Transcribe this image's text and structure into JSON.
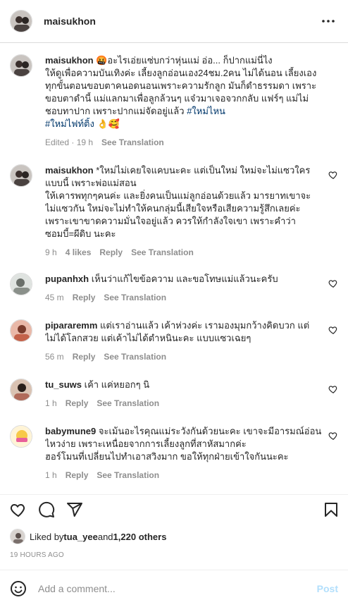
{
  "header": {
    "username": "maisukhon",
    "more_icon": "more-horizontal-icon"
  },
  "comments": [
    {
      "username": "maisukhon",
      "lines": [
        " 🤬อะไรเอ่ยแซ่บกว่าหุ่นแม่ อ่อ... ก็ปากแม่นี่ไง",
        "ให้ดูเพื่อความบันเทิงค่ะ เลี้ยงลูกอ่อนเอง24ชม.2คน ไม่ได้นอน เลี้ยงเอง",
        "ทุกขั้นตอนขอบตาคนอดนอนเพราะความรักลูก มันก็ดำธรรมดา เพราะ",
        "ขอบตาดำนี้ แม่แลกมาเพื่อลูกล้วนๆ แจ๋วมาเจอจวกกลับ แฟร์ๆ แม่ไม่",
        "ชอบทาปาก เพราะปากแม่จัดอยู่แล้ว "
      ],
      "hashtag_1": "#ใหม่ไหน",
      "hashtag_2": "#ใหม่ไฟท์ติ้ง",
      "emoji_tail": " 👌🥰",
      "edited": "Edited · 19 h",
      "see_translation": "See Translation"
    },
    {
      "username": "maisukhon",
      "lines": [
        " *ใหม่ไม่เคยใจแคบนะคะ แต่เป็นใหม่ ใหม่จะไม่แซวใคร",
        "แบบนี้ เพราะพ่อแม่สอน",
        "ให้เคารพทุกๆคนค่ะ และยิ่งคนเป็นแม่ลูกอ่อนด้วยแล้ว มารยาทเขาจะ",
        "ไม่แซวกัน ใหม่จะไม่ทำให้คนกลุ่มนี้เสียใจหรือเสียความรู้สึกเลยค่ะ",
        "เพราะเขาขาดความมั่นใจอยู่แล้ว ควรให้กำลังใจเขา เพราะคำว่า",
        "ซอมบี้=ผีดิบ นะคะ"
      ],
      "time": "9 h",
      "likes": "4 likes",
      "reply": "Reply",
      "see_translation": "See Translation"
    },
    {
      "username": "pupanhxh",
      "lines": [
        " เห็นว่าแก้ไขข้อความ และขอโทษแม่แล้วนะครับ"
      ],
      "time": "45 m",
      "reply": "Reply",
      "see_translation": "See Translation"
    },
    {
      "username": "pipararemm",
      "lines": [
        " แต่เราอ่านแล้ว เค้าห่วงค่ะ เรามองมุมกว้างคิดบวก แต่",
        "ไม่ได้โลกสวย แต่เค้าไม่ได้ตำหนินะคะ แบบแซวเฉยๆ"
      ],
      "time": "56 m",
      "reply": "Reply",
      "see_translation": "See Translation"
    },
    {
      "username": "tu_suws",
      "lines": [
        " เค้า แค่หยอกๆ นิ"
      ],
      "time": "1 h",
      "reply": "Reply",
      "see_translation": "See Translation"
    },
    {
      "username": "babymune9",
      "lines": [
        " จะเม้นอะไรคุณแม่ระวังกันด้วยนะคะ เขาจะมีอารมณ์อ่อน",
        "ไหวง่าย เพราะเหนื่อยจากการเลี้ยงลูกที่สาหัสมากค่ะ",
        "ฮอร์โมนที่เปลี่ยนไปทำเอาสวิงมาก ขอให้ทุกฝ่ายเข้าใจกันนะคะ"
      ],
      "time": "1 h",
      "reply": "Reply",
      "see_translation": "See Translation"
    }
  ],
  "actions": {
    "icons": [
      "heart-icon",
      "comment-icon",
      "share-icon",
      "bookmark-icon"
    ]
  },
  "likes": {
    "prefix": "Liked by ",
    "user": "tua_yee",
    "mid": " and ",
    "count": "1,220 others"
  },
  "post_date": "19 HOURS AGO",
  "add_comment": {
    "placeholder": "Add a comment...",
    "post_label": "Post"
  },
  "colors": {
    "link": "#00376b",
    "muted": "#8e8e8e",
    "post_disabled": "#b2dffc",
    "border": "#dbdbdb"
  }
}
